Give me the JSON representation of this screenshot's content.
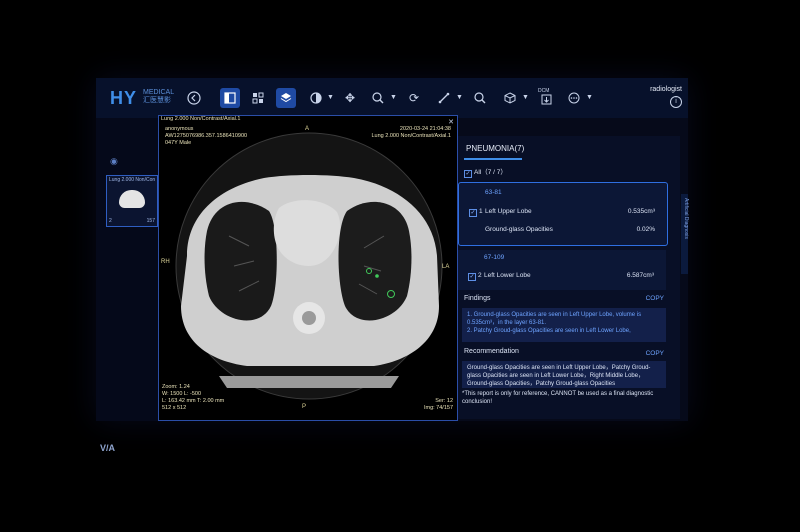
{
  "toolbar": {
    "logo_text": "HY",
    "logo_sub_1": "MEDICAL",
    "logo_sub_2": "汇医慧影",
    "user": "radiologist",
    "tools": [
      "back-icon",
      "single-view-icon",
      "grid-layout-icon",
      "stack-icon",
      "window-level-icon",
      "pan-icon",
      "zoom-icon",
      "rotate-icon",
      "measure-icon",
      "magnifier-icon",
      "3d-icon",
      "dcm-export-icon",
      "more-icon",
      "info-icon"
    ],
    "dcm_label": "DCM"
  },
  "thumbnail": {
    "label": "Lung 2.000 Non/Con",
    "index": "2",
    "count": "157"
  },
  "viewer": {
    "series": "Lung 2.000 Non/Contrast/Axial.1",
    "patient_name": "anonymous",
    "patient_id": "AW1275076986.357.1586410900",
    "patient_info": "047Y Male",
    "datetime": "2020-03-24 21:04:38",
    "series_right": "Lung 2.000 Non/Contrast/Axial.1",
    "orient_top": "A",
    "orient_bottom": "P",
    "orient_left": "RH",
    "orient_right": "LA",
    "zoom": "Zoom: 1.24",
    "window": "W: 1500 L: -500",
    "location": "L: 163.42 mm T: 2.00 mm",
    "matrix": "512 x 512",
    "ser": "Ser: 12",
    "img": "Img: 74/157"
  },
  "report": {
    "side_tab": "Artificial Diagnosis",
    "title": "PNEUMONIA(7)",
    "all_label": "All（7 / 7）",
    "findings_label": "Findings",
    "recommendation_label": "Recommendation",
    "copy_label": "COPY",
    "items": [
      {
        "range": "63-81",
        "index": "1",
        "lobe": "Left Upper Lobe",
        "volume": "0.535cm³",
        "type": "Ground-glass Opacities",
        "percent": "0.02%"
      },
      {
        "range": "67-109",
        "index": "2",
        "lobe": "Left Lower Lobe",
        "volume": "6.587cm³"
      }
    ],
    "findings": [
      {
        "a": "1. Ground-glass Opacities are seen in Left Upper Lobe, volume is 0.535cm³，in the layer 63-81."
      },
      {
        "a": "2. Patchy Groud-glass Opacities are seen in Left Lower Lobe,"
      }
    ],
    "recommendation": "Ground-glass Opacities are seen in Left Upper Lobe，Patchy Groud-glass Opacities are seen in Left Lower Lobe，Right Middle Lobe，Ground-glass Opacities，Patchy Groud-glass Opacities",
    "note": "*This report is only for reference, CANNOT be used as a final diagnostic conclusion!"
  },
  "colors": {
    "accent": "#3f8ee8",
    "active_tool": "#1f4aa3",
    "overlay_text": "#e8e1b8",
    "gauge": "#2b9c3a"
  }
}
